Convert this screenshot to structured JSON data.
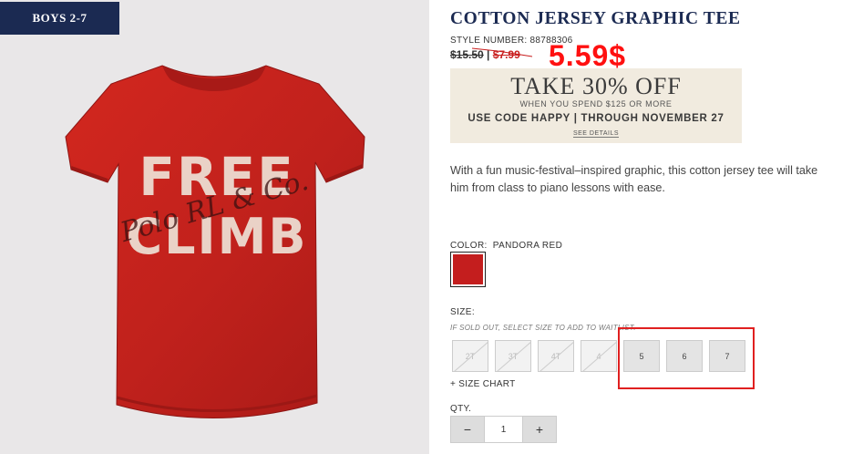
{
  "category": {
    "label": "BOYS 2-7"
  },
  "product": {
    "title": "COTTON JERSEY GRAPHIC TEE",
    "style_number": "STYLE NUMBER: 88788306",
    "original_price": "$15.50",
    "price_separator": "|",
    "sale_price": "$7.99",
    "overlay_price": "5.59$",
    "description": "With a fun music-festival–inspired graphic, this cotton jersey tee will take him from class to piano lessons with ease.",
    "graphic_text": {
      "line1": "FREE",
      "line2": "CLIMB",
      "script": "Polo RL & Co."
    }
  },
  "promo": {
    "headline": "TAKE 30% OFF",
    "subline": "WHEN YOU SPEND $125 OR MORE",
    "code_line": "USE CODE HAPPY | THROUGH NOVEMBER 27",
    "details_link": "SEE DETAILS"
  },
  "color": {
    "label": "COLOR:",
    "value": "PANDORA RED",
    "swatch_hex": "#c41e1e"
  },
  "size": {
    "label": "SIZE:",
    "note": "IF SOLD OUT, SELECT SIZE TO ADD TO WAITLIST.",
    "options": [
      {
        "label": "2T",
        "sold_out": true
      },
      {
        "label": "3T",
        "sold_out": true
      },
      {
        "label": "4T",
        "sold_out": true
      },
      {
        "label": "4",
        "sold_out": true
      },
      {
        "label": "5",
        "sold_out": false
      },
      {
        "label": "6",
        "sold_out": false
      },
      {
        "label": "7",
        "sold_out": false
      }
    ],
    "chart_link": "+ SIZE CHART"
  },
  "quantity": {
    "label": "QTY.",
    "minus": "−",
    "value": "1",
    "plus": "+"
  },
  "colors": {
    "navy": "#1b2a52",
    "sale_red": "#c81e1e",
    "overlay_red": "#ff1010",
    "shirt_red": "#c0211c",
    "promo_bg": "#f1ebdf"
  }
}
